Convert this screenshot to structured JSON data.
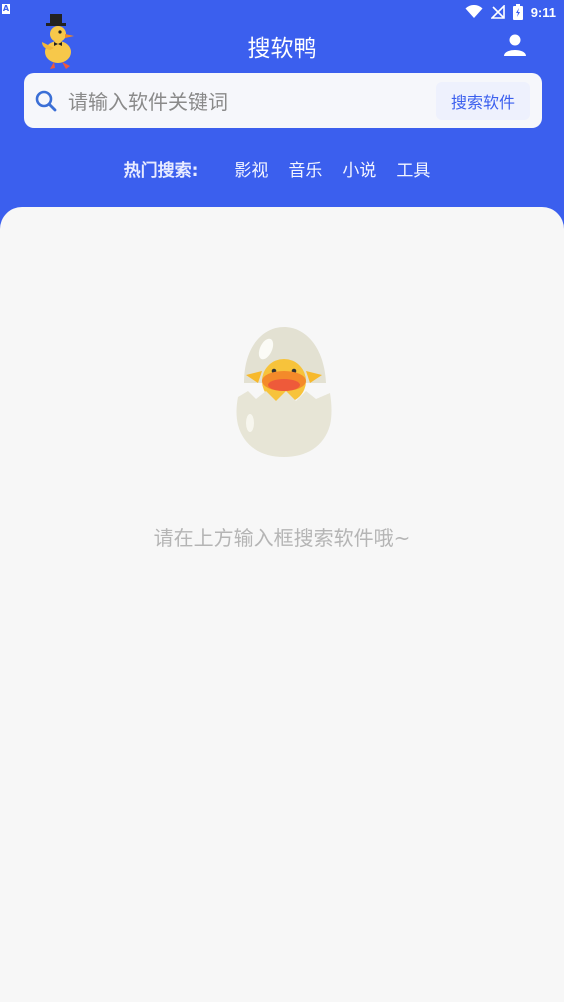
{
  "status_bar": {
    "notification_icon": "A",
    "time": "9:11",
    "icons": [
      "wifi-icon",
      "no-signal-icon",
      "battery-charging-icon"
    ]
  },
  "header": {
    "title": "搜软鸭",
    "logo_icon": "duck-logo-icon",
    "user_icon": "user-icon"
  },
  "search": {
    "placeholder": "请输入软件关键词",
    "value": "",
    "button_label": "搜索软件",
    "icon": "search-icon"
  },
  "hot": {
    "label": "热门搜索:",
    "items": [
      "影视",
      "音乐",
      "小说",
      "工具"
    ]
  },
  "empty_state": {
    "illustration": "duck-egg-icon",
    "message": "请在上方输入框搜索软件哦~"
  },
  "colors": {
    "brand": "#3b5fee",
    "background": "#f7f7f7",
    "muted_text": "#b5b5b5"
  }
}
